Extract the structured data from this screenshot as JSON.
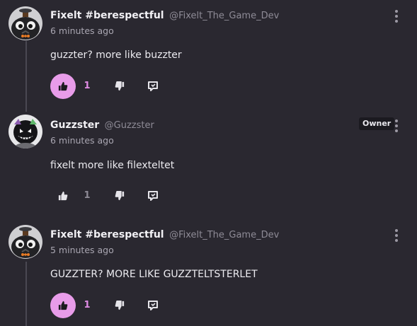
{
  "comments": [
    {
      "author_name": "Fixelt #berespectful",
      "author_handle": "@Fixelt_The_Game_Dev",
      "timestamp": "6 minutes ago",
      "text": "guzzter? more like buzzter",
      "like_count": "1",
      "liked": true,
      "avatar": "black-pumpkin-with-orange-bowtie"
    },
    {
      "author_name": "Guzzster",
      "author_handle": "@Guzzster",
      "timestamp": "6 minutes ago",
      "text": "fixelt more like filexteltet",
      "like_count": "1",
      "liked": false,
      "badge": "Owner",
      "avatar": "grinning-shadow-character"
    },
    {
      "author_name": "Fixelt #berespectful",
      "author_handle": "@Fixelt_The_Game_Dev",
      "timestamp": "5 minutes ago",
      "text": "GUZZTER? MORE LIKE GUZZTELTSTERLET",
      "like_count": "1",
      "liked": true,
      "avatar": "black-pumpkin-with-orange-bowtie"
    }
  ],
  "colors": {
    "background": "#2a2830",
    "like_active_bg": "#e89ce9",
    "like_active_text": "#e28ce6",
    "muted_text": "#8e8b96",
    "badge_bg": "#1b1a20"
  },
  "icons": {
    "like": "thumbs-up-icon",
    "dislike": "thumbs-down-icon",
    "reply": "reply-bubble-icon",
    "menu": "kebab-menu-icon"
  }
}
